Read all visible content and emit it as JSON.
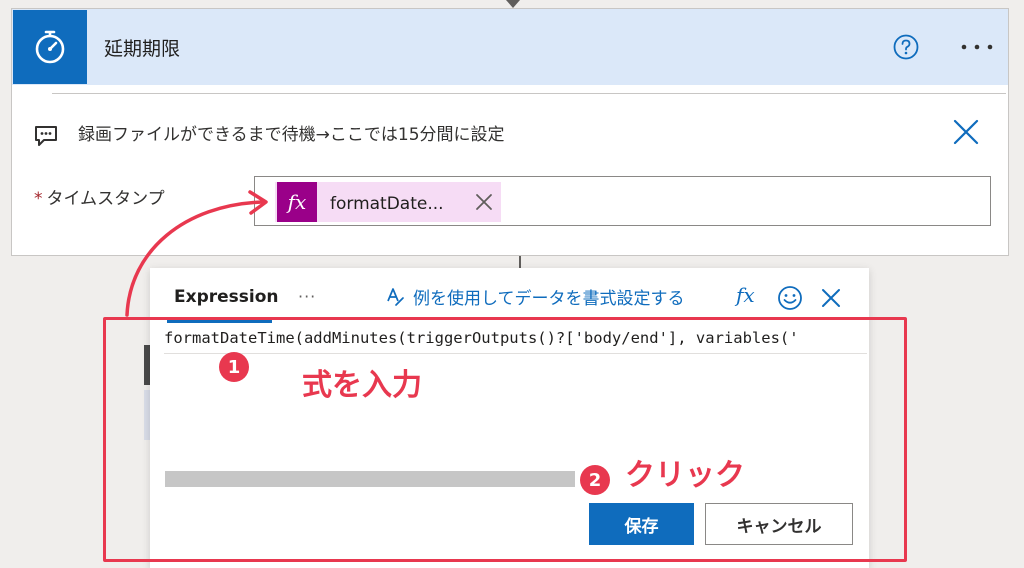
{
  "card": {
    "title": "延期期限",
    "comment": "録画ファイルができるまで待機→ここでは15分間に設定",
    "field_required_mark": "*",
    "field_label": "タイムスタンプ",
    "token_label": "formatDate..."
  },
  "popup": {
    "tab_expression": "Expression",
    "tab_more": "···",
    "format_link": "例を使用してデータを書式設定する",
    "fx_label": "fx",
    "expression_value": "formatDateTime(addMinutes(triggerOutputs()?['body/end'], variables('",
    "save_label": "保存",
    "cancel_label": "キャンセル"
  },
  "annotations": {
    "badge_1": "1",
    "text_1": "式を入力",
    "badge_2": "2",
    "text_2": "クリック"
  },
  "colors": {
    "accent": "#0f6cbd",
    "header_bg": "#dbe8f9",
    "token_bg": "#f6dcf5",
    "token_fx_bg": "#9a0089",
    "annotation": "#e8384f"
  },
  "icons": {
    "card_icon": "stopwatch-icon",
    "help": "help-icon",
    "more": "more-icon",
    "comment": "comment-icon",
    "close": "close-icon",
    "token_remove": "close-icon",
    "format": "format-text-icon",
    "emoji": "smile-icon"
  }
}
